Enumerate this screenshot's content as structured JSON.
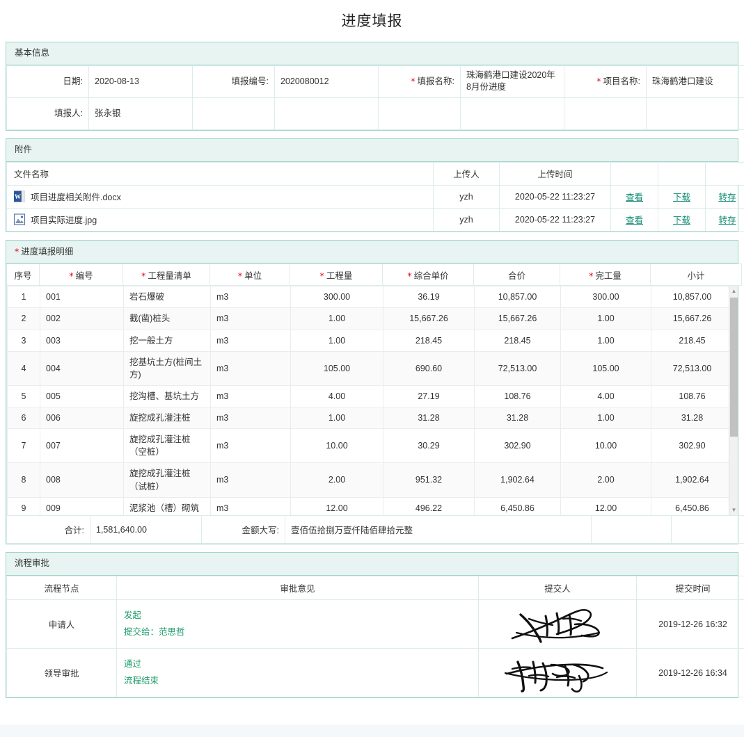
{
  "page": {
    "title": "进度填报"
  },
  "basic_info": {
    "section_title": "基本信息",
    "fields": [
      {
        "label": "日期:",
        "value": "2020-08-13",
        "required": false
      },
      {
        "label": "填报编号:",
        "value": "2020080012",
        "required": false
      },
      {
        "label": "填报名称:",
        "value": "珠海鹤港口建设2020年8月份进度",
        "required": true
      },
      {
        "label": "项目名称:",
        "value": "珠海鹤港口建设",
        "required": true
      },
      {
        "label": "填报人:",
        "value": "张永银",
        "required": false
      }
    ]
  },
  "attachments": {
    "section_title": "附件",
    "columns": [
      "文件名称",
      "上传人",
      "上传时间",
      "",
      "",
      ""
    ],
    "actions": {
      "view": "查看",
      "download": "下载",
      "save": "转存"
    },
    "rows": [
      {
        "icon": "word-file-icon",
        "name": "项目进度相关附件.docx",
        "uploader": "yzh",
        "time": "2020-05-22 11:23:27"
      },
      {
        "icon": "image-file-icon",
        "name": "项目实际进度.jpg",
        "uploader": "yzh",
        "time": "2020-05-22 11:23:27"
      }
    ]
  },
  "detail": {
    "section_title": "进度填报明细",
    "section_required": true,
    "columns": [
      {
        "label": "序号",
        "required": false
      },
      {
        "label": "编号",
        "required": true
      },
      {
        "label": "工程量清单",
        "required": true
      },
      {
        "label": "单位",
        "required": true
      },
      {
        "label": "工程量",
        "required": true
      },
      {
        "label": "综合单价",
        "required": true
      },
      {
        "label": "合价",
        "required": false
      },
      {
        "label": "完工量",
        "required": true
      },
      {
        "label": "小计",
        "required": false
      }
    ],
    "rows": [
      {
        "seq": "1",
        "code": "001",
        "item": "岩石爆破",
        "unit": "m3",
        "qty": "300.00",
        "unit_price": "36.19",
        "total_price": "10,857.00",
        "done_qty": "300.00",
        "subtotal": "10,857.00"
      },
      {
        "seq": "2",
        "code": "002",
        "item": "截(凿)桩头",
        "unit": "m3",
        "qty": "1.00",
        "unit_price": "15,667.26",
        "total_price": "15,667.26",
        "done_qty": "1.00",
        "subtotal": "15,667.26"
      },
      {
        "seq": "3",
        "code": "003",
        "item": "挖一般土方",
        "unit": "m3",
        "qty": "1.00",
        "unit_price": "218.45",
        "total_price": "218.45",
        "done_qty": "1.00",
        "subtotal": "218.45"
      },
      {
        "seq": "4",
        "code": "004",
        "item": "挖基坑土方(桩间土方)",
        "unit": "m3",
        "qty": "105.00",
        "unit_price": "690.60",
        "total_price": "72,513.00",
        "done_qty": "105.00",
        "subtotal": "72,513.00"
      },
      {
        "seq": "5",
        "code": "005",
        "item": "挖沟槽、基坑土方",
        "unit": "m3",
        "qty": "4.00",
        "unit_price": "27.19",
        "total_price": "108.76",
        "done_qty": "4.00",
        "subtotal": "108.76"
      },
      {
        "seq": "6",
        "code": "006",
        "item": "旋挖成孔灌注桩",
        "unit": "m3",
        "qty": "1.00",
        "unit_price": "31.28",
        "total_price": "31.28",
        "done_qty": "1.00",
        "subtotal": "31.28"
      },
      {
        "seq": "7",
        "code": "007",
        "item": "旋挖成孔灌注桩（空桩）",
        "unit": "m3",
        "qty": "10.00",
        "unit_price": "30.29",
        "total_price": "302.90",
        "done_qty": "10.00",
        "subtotal": "302.90"
      },
      {
        "seq": "8",
        "code": "008",
        "item": "旋挖成孔灌注桩（试桩）",
        "unit": "m3",
        "qty": "2.00",
        "unit_price": "951.32",
        "total_price": "1,902.64",
        "done_qty": "2.00",
        "subtotal": "1,902.64"
      },
      {
        "seq": "9",
        "code": "009",
        "item": "泥浆池（槽）砌筑",
        "unit": "m3",
        "qty": "12.00",
        "unit_price": "496.22",
        "total_price": "6,450.86",
        "done_qty": "12.00",
        "subtotal": "6,450.86"
      }
    ],
    "footer": {
      "total_label": "合计:",
      "total_value": "1,581,640.00",
      "capital_label": "金额大写:",
      "capital_value": "壹佰伍拾捌万壹仟陆佰肆拾元整"
    }
  },
  "flow": {
    "section_title": "流程审批",
    "columns": [
      "流程节点",
      "审批意见",
      "提交人",
      "提交时间"
    ],
    "rows": [
      {
        "node": "申请人",
        "opinion_line1": "发起",
        "opinion_line2": "提交给：范思哲",
        "signer": "signature-zhang-yongyin",
        "time": "2019-12-26 16:32"
      },
      {
        "node": "领导审批",
        "opinion_line1": "通过",
        "opinion_line2": "流程结束",
        "signer": "signature-fan-sizhe",
        "time": "2019-12-26 16:34"
      }
    ]
  },
  "colors": {
    "panel_border": "#9fd4cc",
    "panel_head_bg": "#e7f4f1",
    "link": "#0f8a72",
    "required_star": "#e60012",
    "flow_opinion": "#1f9d6c"
  }
}
